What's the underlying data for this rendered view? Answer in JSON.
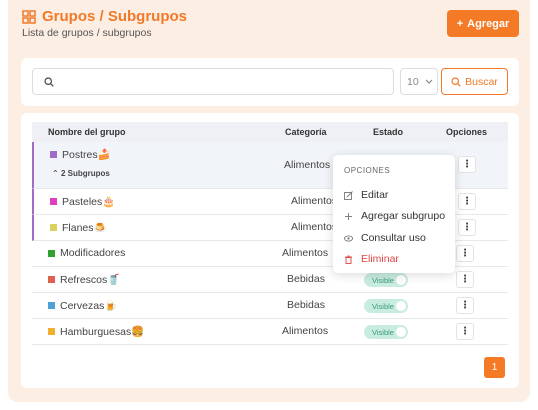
{
  "header": {
    "title": "Grupos / Subgrupos",
    "subtitle": "Lista de grupos / subgrupos",
    "add_label": "Agregar"
  },
  "search": {
    "placeholder": "",
    "per_page": "10",
    "button_label": "Buscar"
  },
  "table": {
    "columns": [
      "Nombre del grupo",
      "Categoría",
      "Estado",
      "Opciones"
    ],
    "rows": [
      {
        "name": "Postres🍰",
        "category": "Alimentos",
        "color": "#a06cc8",
        "subcount": "2 Subgrupos"
      },
      {
        "name": "Pasteles🎂",
        "category": "Alimentos",
        "color": "#e040c0"
      },
      {
        "name": "Flanes🍮",
        "category": "Alimentos",
        "color": "#d8d060"
      },
      {
        "name": "Modificadores",
        "category": "Alimentos",
        "color": "#30a030"
      },
      {
        "name": "Refrescos🥤",
        "category": "Bebidas",
        "color": "#e06050",
        "status": "Visible"
      },
      {
        "name": "Cervezas🍺",
        "category": "Bebidas",
        "color": "#50a0d8",
        "status": "Visible"
      },
      {
        "name": "Hamburguesas🍔",
        "category": "Alimentos",
        "color": "#f0b030",
        "status": "Visible"
      }
    ]
  },
  "menu": {
    "header": "OPCIONES",
    "items": [
      "Editar",
      "Agregar subgrupo",
      "Consultar uso",
      "Eliminar"
    ]
  },
  "pagination": {
    "current": "1"
  },
  "colors": {
    "accent": "#f47a26",
    "background": "#fdeee3"
  }
}
